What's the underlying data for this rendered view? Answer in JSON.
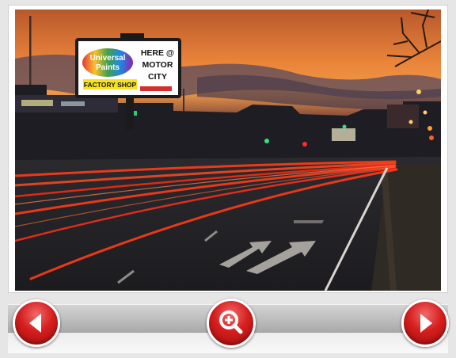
{
  "photo": {
    "billboard_line1": "Universal",
    "billboard_line2": "Paints",
    "billboard_line3": "FACTORY SHOP",
    "billboard_right1": "HERE @",
    "billboard_right2": "MOTOR",
    "billboard_right3": "CITY"
  },
  "controls": {
    "prev_icon": "arrow-left-icon",
    "zoom_icon": "zoom-in-icon",
    "next_icon": "arrow-right-icon"
  },
  "colors": {
    "button_red": "#d61e1e",
    "sky_orange": "#e8772c",
    "light_trail_red": "#ff3b1a"
  }
}
